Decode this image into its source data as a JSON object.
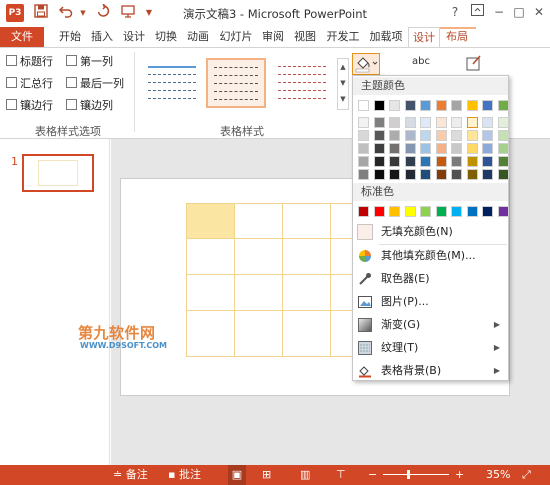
{
  "titlebar": {
    "app_icon": "P3",
    "title": "演示文稿3 - Microsoft PowerPoint",
    "save_icon": "save-icon",
    "undo_icon": "undo-icon",
    "redo_icon": "redo-icon",
    "customize_icon": "customize-quick-access-icon",
    "help": "?",
    "restore_icon": "ribbon-display-icon",
    "minimize": "−",
    "maximize": "□",
    "close": "✕"
  },
  "tabs": {
    "file": "文件",
    "home": "开始",
    "insert": "插入",
    "design": "设计",
    "transitions": "切换",
    "animations": "动画",
    "slideshow": "幻灯片",
    "review": "审阅",
    "view": "视图",
    "developer": "开发工",
    "addins": "加载项",
    "table_design": "设计",
    "table_layout": "布局"
  },
  "ribbon": {
    "options": {
      "header_row": "标题行",
      "first_column": "第一列",
      "total_row": "汇总行",
      "last_column": "最后一列",
      "banded_rows": "镶边行",
      "banded_columns": "镶边列",
      "group_label": "表格样式选项"
    },
    "styles": {
      "group_label": "表格样式"
    },
    "wordart_label": "abc"
  },
  "accent_color": "#d24726",
  "dropdown": {
    "theme_heading": "主题颜色",
    "standard_heading": "标准色",
    "theme_top_row": [
      "#ffffff",
      "#000000",
      "#e7e6e6",
      "#44546a",
      "#5b9bd5",
      "#ed7d31",
      "#a5a5a5",
      "#ffc000",
      "#4472c4",
      "#70ad47"
    ],
    "theme_shades": [
      [
        "#f2f2f2",
        "#7f7f7f",
        "#d0cece",
        "#d6dce4",
        "#deebf6",
        "#fbe5d5",
        "#ededed",
        "#fff2cc",
        "#dae3f3",
        "#e2efd9"
      ],
      [
        "#d8d8d8",
        "#595959",
        "#aeabab",
        "#adb9ca",
        "#bdd7ee",
        "#f7cbac",
        "#dbdbdb",
        "#fee599",
        "#b4c6e7",
        "#c5e0b3"
      ],
      [
        "#bfbfbf",
        "#3f3f3f",
        "#757070",
        "#8496b0",
        "#9cc3e5",
        "#f4b183",
        "#c9c9c9",
        "#ffd966",
        "#8eaadb",
        "#a8d08d"
      ],
      [
        "#a5a5a5",
        "#262626",
        "#3a3838",
        "#323f4f",
        "#2e75b5",
        "#c55a11",
        "#7b7b7b",
        "#bf9000",
        "#2f5496",
        "#538135"
      ],
      [
        "#7f7f7f",
        "#0c0c0c",
        "#171616",
        "#222a35",
        "#1e4e79",
        "#833c0b",
        "#525252",
        "#7f6000",
        "#1f3864",
        "#375623"
      ]
    ],
    "standard_colors": [
      "#c00000",
      "#ff0000",
      "#ffc000",
      "#ffff00",
      "#92d050",
      "#00b050",
      "#00b0f0",
      "#0070c0",
      "#002060",
      "#7030a0"
    ],
    "no_fill": "无填充颜色(N)",
    "more_fill": "其他填充颜色(M)...",
    "eyedropper": "取色器(E)",
    "picture": "图片(P)...",
    "gradient": "渐变(G)",
    "texture": "纹理(T)",
    "table_background": "表格背景(B)"
  },
  "slide_panel": {
    "slide_number": "1"
  },
  "watermark": {
    "brand": "第九软件网",
    "url": "WWW.D9SOFT.COM"
  },
  "statusbar": {
    "notes": "备注",
    "comments": "批注",
    "zoom_minus": "−",
    "zoom_plus": "+",
    "zoom_level": "35%"
  }
}
